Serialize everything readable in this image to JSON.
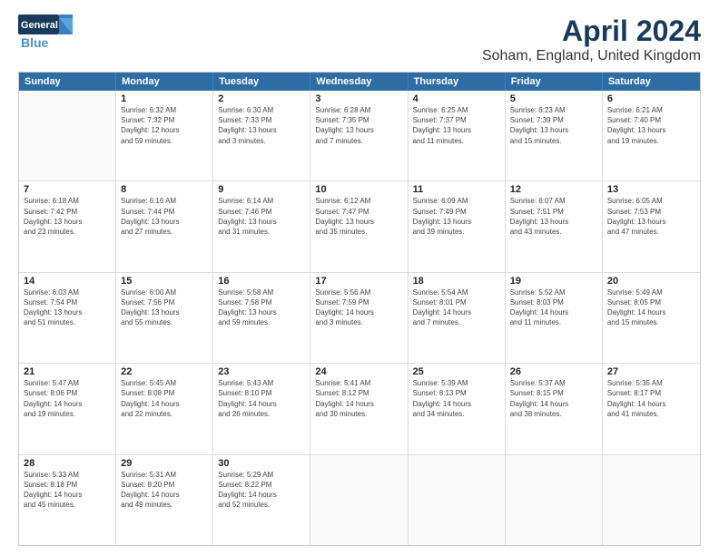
{
  "header": {
    "logo_line1": "General",
    "logo_line2": "Blue",
    "main_title": "April 2024",
    "subtitle": "Soham, England, United Kingdom"
  },
  "days_of_week": [
    "Sunday",
    "Monday",
    "Tuesday",
    "Wednesday",
    "Thursday",
    "Friday",
    "Saturday"
  ],
  "weeks": [
    [
      {
        "day": "",
        "lines": []
      },
      {
        "day": "1",
        "lines": [
          "Sunrise: 6:32 AM",
          "Sunset: 7:32 PM",
          "Daylight: 12 hours",
          "and 59 minutes."
        ]
      },
      {
        "day": "2",
        "lines": [
          "Sunrise: 6:30 AM",
          "Sunset: 7:33 PM",
          "Daylight: 13 hours",
          "and 3 minutes."
        ]
      },
      {
        "day": "3",
        "lines": [
          "Sunrise: 6:28 AM",
          "Sunset: 7:35 PM",
          "Daylight: 13 hours",
          "and 7 minutes."
        ]
      },
      {
        "day": "4",
        "lines": [
          "Sunrise: 6:25 AM",
          "Sunset: 7:37 PM",
          "Daylight: 13 hours",
          "and 11 minutes."
        ]
      },
      {
        "day": "5",
        "lines": [
          "Sunrise: 6:23 AM",
          "Sunset: 7:39 PM",
          "Daylight: 13 hours",
          "and 15 minutes."
        ]
      },
      {
        "day": "6",
        "lines": [
          "Sunrise: 6:21 AM",
          "Sunset: 7:40 PM",
          "Daylight: 13 hours",
          "and 19 minutes."
        ]
      }
    ],
    [
      {
        "day": "7",
        "lines": [
          "Sunrise: 6:18 AM",
          "Sunset: 7:42 PM",
          "Daylight: 13 hours",
          "and 23 minutes."
        ]
      },
      {
        "day": "8",
        "lines": [
          "Sunrise: 6:16 AM",
          "Sunset: 7:44 PM",
          "Daylight: 13 hours",
          "and 27 minutes."
        ]
      },
      {
        "day": "9",
        "lines": [
          "Sunrise: 6:14 AM",
          "Sunset: 7:46 PM",
          "Daylight: 13 hours",
          "and 31 minutes."
        ]
      },
      {
        "day": "10",
        "lines": [
          "Sunrise: 6:12 AM",
          "Sunset: 7:47 PM",
          "Daylight: 13 hours",
          "and 35 minutes."
        ]
      },
      {
        "day": "11",
        "lines": [
          "Sunrise: 6:09 AM",
          "Sunset: 7:49 PM",
          "Daylight: 13 hours",
          "and 39 minutes."
        ]
      },
      {
        "day": "12",
        "lines": [
          "Sunrise: 6:07 AM",
          "Sunset: 7:51 PM",
          "Daylight: 13 hours",
          "and 43 minutes."
        ]
      },
      {
        "day": "13",
        "lines": [
          "Sunrise: 6:05 AM",
          "Sunset: 7:53 PM",
          "Daylight: 13 hours",
          "and 47 minutes."
        ]
      }
    ],
    [
      {
        "day": "14",
        "lines": [
          "Sunrise: 6:03 AM",
          "Sunset: 7:54 PM",
          "Daylight: 13 hours",
          "and 51 minutes."
        ]
      },
      {
        "day": "15",
        "lines": [
          "Sunrise: 6:00 AM",
          "Sunset: 7:56 PM",
          "Daylight: 13 hours",
          "and 55 minutes."
        ]
      },
      {
        "day": "16",
        "lines": [
          "Sunrise: 5:58 AM",
          "Sunset: 7:58 PM",
          "Daylight: 13 hours",
          "and 59 minutes."
        ]
      },
      {
        "day": "17",
        "lines": [
          "Sunrise: 5:56 AM",
          "Sunset: 7:59 PM",
          "Daylight: 14 hours",
          "and 3 minutes."
        ]
      },
      {
        "day": "18",
        "lines": [
          "Sunrise: 5:54 AM",
          "Sunset: 8:01 PM",
          "Daylight: 14 hours",
          "and 7 minutes."
        ]
      },
      {
        "day": "19",
        "lines": [
          "Sunrise: 5:52 AM",
          "Sunset: 8:03 PM",
          "Daylight: 14 hours",
          "and 11 minutes."
        ]
      },
      {
        "day": "20",
        "lines": [
          "Sunrise: 5:49 AM",
          "Sunset: 8:05 PM",
          "Daylight: 14 hours",
          "and 15 minutes."
        ]
      }
    ],
    [
      {
        "day": "21",
        "lines": [
          "Sunrise: 5:47 AM",
          "Sunset: 8:06 PM",
          "Daylight: 14 hours",
          "and 19 minutes."
        ]
      },
      {
        "day": "22",
        "lines": [
          "Sunrise: 5:45 AM",
          "Sunset: 8:08 PM",
          "Daylight: 14 hours",
          "and 22 minutes."
        ]
      },
      {
        "day": "23",
        "lines": [
          "Sunrise: 5:43 AM",
          "Sunset: 8:10 PM",
          "Daylight: 14 hours",
          "and 26 minutes."
        ]
      },
      {
        "day": "24",
        "lines": [
          "Sunrise: 5:41 AM",
          "Sunset: 8:12 PM",
          "Daylight: 14 hours",
          "and 30 minutes."
        ]
      },
      {
        "day": "25",
        "lines": [
          "Sunrise: 5:39 AM",
          "Sunset: 8:13 PM",
          "Daylight: 14 hours",
          "and 34 minutes."
        ]
      },
      {
        "day": "26",
        "lines": [
          "Sunrise: 5:37 AM",
          "Sunset: 8:15 PM",
          "Daylight: 14 hours",
          "and 38 minutes."
        ]
      },
      {
        "day": "27",
        "lines": [
          "Sunrise: 5:35 AM",
          "Sunset: 8:17 PM",
          "Daylight: 14 hours",
          "and 41 minutes."
        ]
      }
    ],
    [
      {
        "day": "28",
        "lines": [
          "Sunrise: 5:33 AM",
          "Sunset: 8:18 PM",
          "Daylight: 14 hours",
          "and 45 minutes."
        ]
      },
      {
        "day": "29",
        "lines": [
          "Sunrise: 5:31 AM",
          "Sunset: 8:20 PM",
          "Daylight: 14 hours",
          "and 49 minutes."
        ]
      },
      {
        "day": "30",
        "lines": [
          "Sunrise: 5:29 AM",
          "Sunset: 8:22 PM",
          "Daylight: 14 hours",
          "and 52 minutes."
        ]
      },
      {
        "day": "",
        "lines": []
      },
      {
        "day": "",
        "lines": []
      },
      {
        "day": "",
        "lines": []
      },
      {
        "day": "",
        "lines": []
      }
    ]
  ]
}
